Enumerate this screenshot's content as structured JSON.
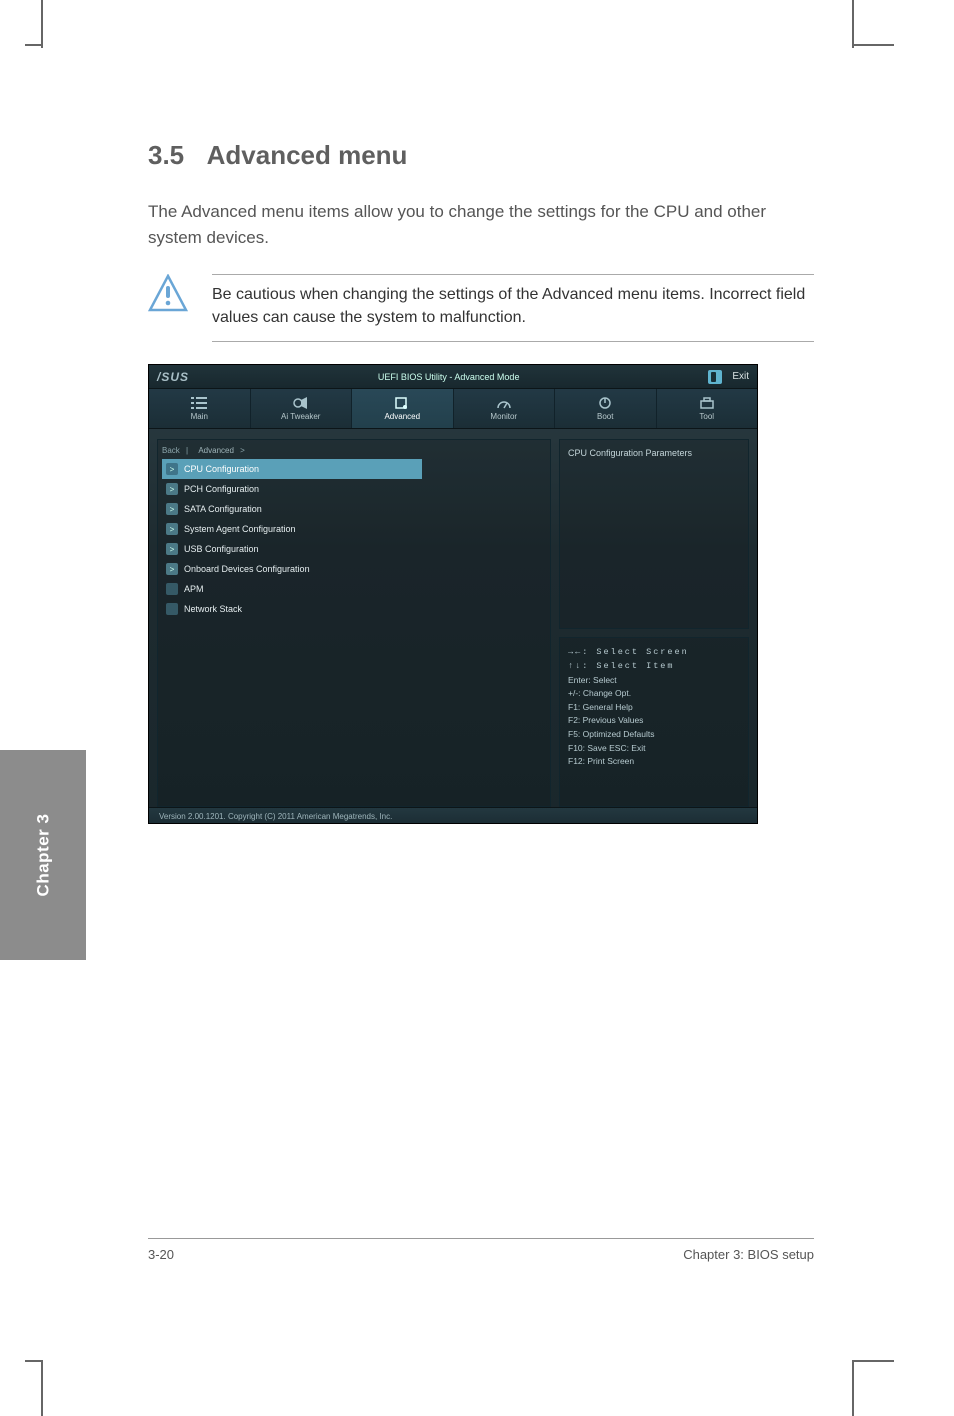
{
  "doc": {
    "section_number": "3.5",
    "section_title": "Advanced menu",
    "section_desc": "The Advanced menu items allow you to change the settings for the CPU and other system devices.",
    "note_text": "Be cautious when changing the settings of the Advanced menu items. Incorrect field values can cause the system to malfunction."
  },
  "bios": {
    "logo": "/SUS",
    "mode": "UEFI BIOS Utility - Advanced Mode",
    "exit_label": "Exit",
    "tabs": [
      {
        "label": "Main"
      },
      {
        "label": "Ai Tweaker"
      },
      {
        "label": "Advanced"
      },
      {
        "label": "Monitor"
      },
      {
        "label": "Boot"
      },
      {
        "label": "Tool"
      }
    ],
    "active_tab_index": 2,
    "back_label": "Back",
    "left_header": "Advanced",
    "menu_items": [
      "CPU Configuration",
      "PCH Configuration",
      "SATA Configuration",
      "System Agent Configuration",
      "USB Configuration",
      "Onboard Devices Configuration",
      "APM",
      "Network Stack"
    ],
    "help_text": "CPU Configuration Parameters",
    "hints": [
      "→←: Select Screen",
      "↑↓: Select Item",
      "Enter: Select",
      "+/-: Change Opt.",
      "F1: General Help",
      "F2: Previous Values",
      "F5: Optimized Defaults",
      "F10: Save ESC: Exit",
      "F12: Print Screen"
    ],
    "footer_left": "Version 2.00.1201. Copyright (C) 2011 American Megatrends, Inc.",
    "footer_right": ""
  },
  "chapter": {
    "label": "Chapter 3",
    "sublabel": "Chapter 3"
  },
  "footer": {
    "left": "3-20",
    "right": "Chapter 3: BIOS setup"
  }
}
